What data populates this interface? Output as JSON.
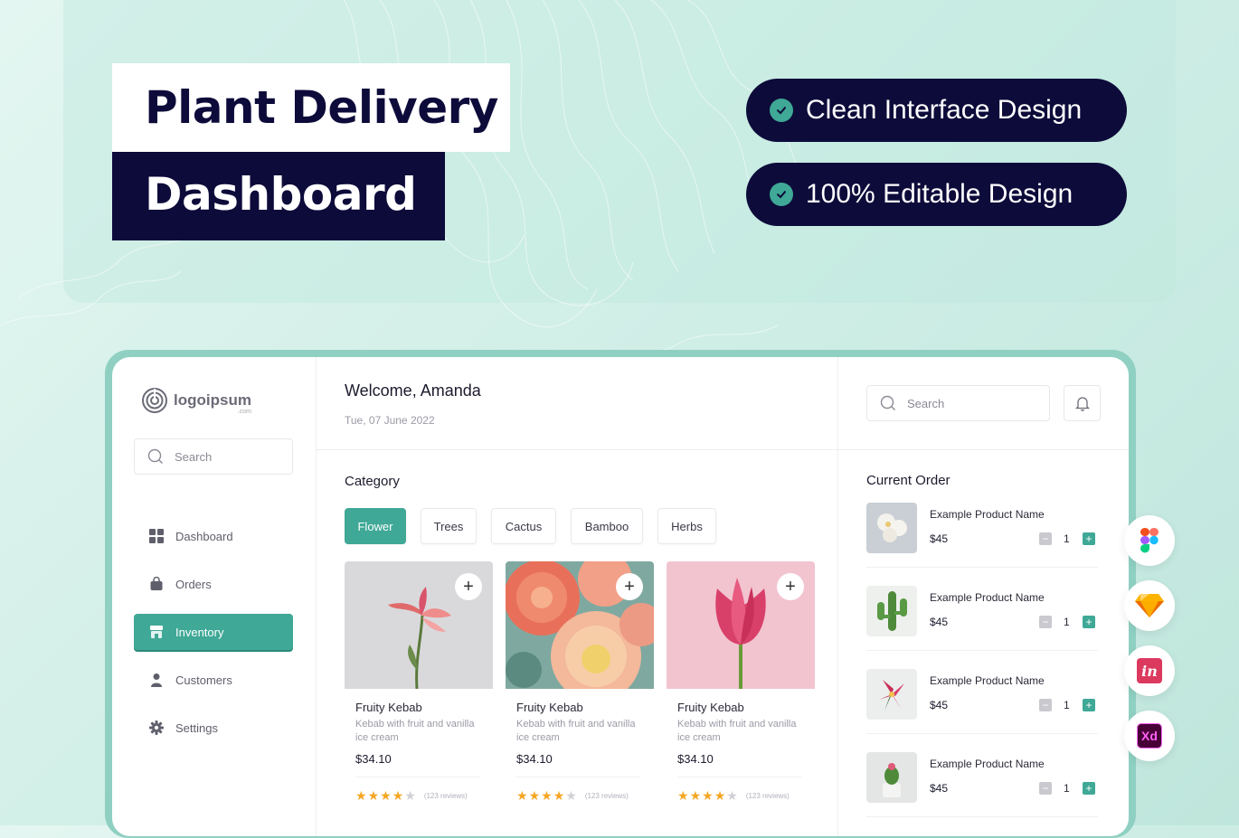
{
  "promo": {
    "title_line1": "Plant Delivery",
    "title_line2": "Dashboard",
    "features": [
      "Clean Interface Design",
      "100% Editable Design"
    ]
  },
  "sidebar": {
    "logo_text": "logoipsum",
    "logo_sub": ".com",
    "search_placeholder": "Search",
    "nav": [
      {
        "label": "Dashboard",
        "icon": "grid-icon"
      },
      {
        "label": "Orders",
        "icon": "bag-icon"
      },
      {
        "label": "Inventory",
        "icon": "store-icon",
        "active": true
      },
      {
        "label": "Customers",
        "icon": "user-icon"
      },
      {
        "label": "Settings",
        "icon": "gear-icon"
      }
    ]
  },
  "header": {
    "welcome": "Welcome, Amanda",
    "date": "Tue, 07 June 2022"
  },
  "category": {
    "title": "Category",
    "chips": [
      "Flower",
      "Trees",
      "Cactus",
      "Bamboo",
      "Herbs"
    ],
    "selected": "Flower"
  },
  "products": [
    {
      "name": "Fruity Kebab",
      "desc": "Kebab with fruit and vanilla ice cream",
      "price": "$34.10",
      "rating": 4,
      "reviews": "(123 reviews)"
    },
    {
      "name": "Fruity Kebab",
      "desc": "Kebab with fruit and vanilla ice cream",
      "price": "$34.10",
      "rating": 4,
      "reviews": "(123 reviews)"
    },
    {
      "name": "Fruity Kebab",
      "desc": "Kebab with fruit and vanilla ice cream",
      "price": "$34.10",
      "rating": 4,
      "reviews": "(123 reviews)"
    }
  ],
  "right": {
    "search_placeholder": "Search",
    "current_order_title": "Current Order",
    "items": [
      {
        "name": "Example Product Name",
        "price": "$45",
        "qty": "1"
      },
      {
        "name": "Example Product Name",
        "price": "$45",
        "qty": "1"
      },
      {
        "name": "Example Product Name",
        "price": "$45",
        "qty": "1"
      },
      {
        "name": "Example Product Name",
        "price": "$45",
        "qty": "1"
      }
    ]
  },
  "tools": [
    "figma-icon",
    "sketch-icon",
    "invision-icon",
    "xd-icon"
  ],
  "tool_labels": {
    "invision": "in",
    "xd": "Xd"
  },
  "colors": {
    "accent": "#3fa896",
    "navy": "#0d0b3a",
    "star": "#f5a623"
  }
}
